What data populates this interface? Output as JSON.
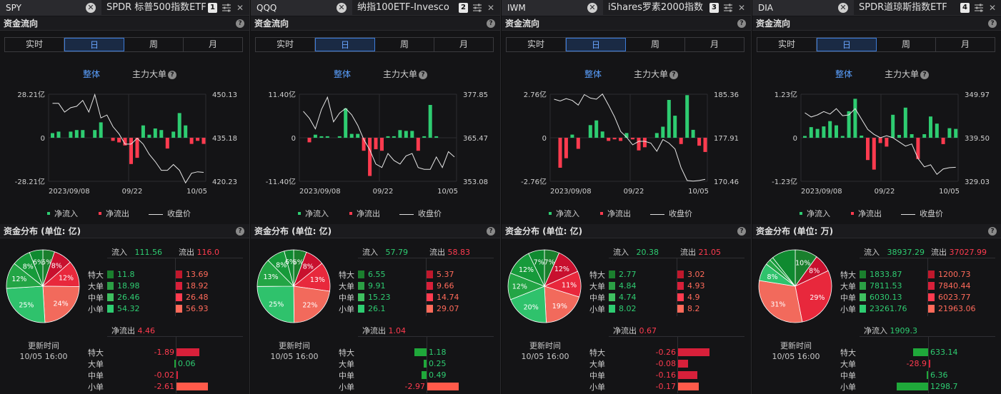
{
  "labels": {
    "flow_section": "资金流向",
    "dist_prefix": "资金分布 (单位: ",
    "dist_suffix": ")",
    "segments": [
      "实时",
      "日",
      "周",
      "月"
    ],
    "active_segment": "日",
    "mode_all": "整体",
    "mode_main": "主力大单",
    "legend_in": "净流入",
    "legend_out": "净流出",
    "legend_price": "收盘价",
    "inflow": "流入",
    "outflow": "流出",
    "row_labels": [
      "特大",
      "大单",
      "中单",
      "小单"
    ],
    "update_label": "更新时间",
    "update_time": "10/05 16:00"
  },
  "colors": {
    "green": "#2ecc71",
    "red": "#ff3b4f",
    "accent": "#5aa0ff"
  },
  "panels": [
    {
      "ticker": "SPY",
      "name": "SPDR 标普500指数ETF",
      "tab_index": "1",
      "unit": "亿",
      "chart_data": {
        "type": "bar",
        "y_left_ticks": [
          "28.21亿",
          "0",
          "-28.21亿"
        ],
        "y_right_ticks": [
          "450.13",
          "435.18",
          "420.23"
        ],
        "x_ticks": [
          "2023/09/08",
          "09/22",
          "10/05"
        ],
        "y_left_range": [
          -28.21,
          28.21
        ],
        "y_right_range": [
          420.23,
          450.13
        ],
        "net_flow": [
          3,
          4,
          0,
          4,
          5,
          5,
          0,
          5,
          10,
          0,
          -2,
          -3,
          -5,
          -17,
          -13,
          8,
          2,
          6,
          5,
          -7,
          4,
          16,
          8,
          -4,
          -2,
          -4
        ],
        "close": [
          447,
          447,
          444,
          445.5,
          446,
          448,
          444,
          450,
          442,
          443,
          439,
          436.5,
          433,
          433,
          435,
          433,
          429.5,
          427,
          424,
          424,
          426,
          424,
          419.7,
          423,
          423.5,
          423.3
        ]
      },
      "dist": {
        "inflow": "111.56",
        "outflow": "116.0",
        "in": [
          "11.8",
          "18.98",
          "26.46",
          "54.32"
        ],
        "out": [
          "13.69",
          "18.92",
          "26.48",
          "56.93"
        ],
        "net_label": "净流出",
        "net_value": "4.46",
        "net_sign": "out",
        "net": [
          "-1.89",
          "0.06",
          "-0.02",
          "-2.61"
        ],
        "pie": [
          {
            "label": "5%",
            "value": 5.2
          },
          {
            "label": "8%",
            "value": 8.3
          },
          {
            "label": "12%",
            "value": 11.6
          },
          {
            "label": "24%",
            "value": 23.9
          },
          {
            "label": "25%",
            "value": 24.9
          },
          {
            "label": "12%",
            "value": 11.6
          },
          {
            "label": "8%",
            "value": 8.3
          },
          {
            "label": "6%",
            "value": 6.0
          }
        ]
      }
    },
    {
      "ticker": "QQQ",
      "name": "纳指100ETF-Invesco",
      "tab_index": "2",
      "unit": "亿",
      "chart_data": {
        "type": "bar",
        "y_left_ticks": [
          "11.40亿",
          "0",
          "-11.40亿"
        ],
        "y_right_ticks": [
          "377.85",
          "365.47",
          "353.08"
        ],
        "x_ticks": [
          "2023/09/08",
          "09/22",
          "10/05"
        ],
        "y_left_range": [
          -11.4,
          11.4
        ],
        "y_right_range": [
          353.08,
          377.85
        ],
        "net_flow": [
          0,
          -1.2,
          0.8,
          0.4,
          0.4,
          0,
          0.4,
          7.7,
          1,
          1,
          -3.4,
          -10,
          -3,
          -3.4,
          0.4,
          0.4,
          2,
          1.8,
          1.8,
          -3.4,
          0.4,
          8.6,
          0.4,
          0,
          0,
          0
        ],
        "close": [
          373,
          371,
          368,
          373.5,
          377,
          370,
          372.5,
          373.8,
          372,
          369,
          365,
          362,
          358,
          357,
          361,
          359,
          358,
          360.3,
          361,
          357,
          356.5,
          356.5,
          360,
          357,
          361.5,
          360
        ]
      },
      "dist": {
        "inflow": "57.79",
        "outflow": "58.83",
        "in": [
          "6.55",
          "9.91",
          "15.23",
          "26.1"
        ],
        "out": [
          "5.37",
          "9.66",
          "14.74",
          "29.07"
        ],
        "net_label": "净流出",
        "net_value": "1.04",
        "net_sign": "out",
        "net": [
          "1.18",
          "0.25",
          "0.49",
          "-2.97"
        ],
        "pie": [
          {
            "label": "6%",
            "value": 5.7
          },
          {
            "label": "8%",
            "value": 8.5
          },
          {
            "label": "13%",
            "value": 13.0
          },
          {
            "label": "22%",
            "value": 22.6
          },
          {
            "label": "25%",
            "value": 25.1
          },
          {
            "label": "13%",
            "value": 12.7
          },
          {
            "label": "8%",
            "value": 8.2
          },
          {
            "label": "6%",
            "value": 4.2
          }
        ]
      }
    },
    {
      "ticker": "IWM",
      "name": "iShares罗素2000指数",
      "tab_index": "3",
      "unit": "亿",
      "chart_data": {
        "type": "bar",
        "y_left_ticks": [
          "2.76亿",
          "0",
          "-2.76亿"
        ],
        "y_right_ticks": [
          "185.36",
          "177.91",
          "170.46"
        ],
        "x_ticks": [
          "2023/09/08",
          "09/22",
          "10/05"
        ],
        "y_left_range": [
          -2.76,
          2.76
        ],
        "y_right_range": [
          170.46,
          185.36
        ],
        "net_flow": [
          0,
          -1.9,
          -1.3,
          0.2,
          -0.7,
          0,
          0.8,
          1.1,
          0.4,
          -0.2,
          -0.1,
          -0.2,
          0.3,
          -0.1,
          -0.8,
          -0.6,
          0,
          0.3,
          0.7,
          2.4,
          1.4,
          -0.4,
          2.7,
          0.5,
          -0.5,
          -0.9
        ],
        "close": [
          184.5,
          184.2,
          184.6,
          184.3,
          183.5,
          185.3,
          184.7,
          184.5,
          185.4,
          183.5,
          181.5,
          179,
          178,
          176.7,
          177.3,
          177.3,
          177,
          175.6,
          177.6,
          177,
          176,
          172.8,
          170.6,
          170.5,
          170.6,
          170.8
        ]
      },
      "dist": {
        "inflow": "20.38",
        "outflow": "21.05",
        "in": [
          "2.77",
          "4.84",
          "4.74",
          "8.02"
        ],
        "out": [
          "3.02",
          "4.93",
          "4.9",
          "8.2"
        ],
        "net_label": "净流出",
        "net_value": "0.67",
        "net_sign": "out",
        "net": [
          "-0.26",
          "-0.08",
          "-0.16",
          "-0.17"
        ],
        "pie": [
          {
            "label": "7%",
            "value": 6.6
          },
          {
            "label": "12%",
            "value": 11.7
          },
          {
            "label": "11%",
            "value": 11.5
          },
          {
            "label": "19%",
            "value": 19.4
          },
          {
            "label": "20%",
            "value": 19.8
          },
          {
            "label": "12%",
            "value": 11.9
          },
          {
            "label": "12%",
            "value": 11.9
          },
          {
            "label": "7%",
            "value": 7.2
          }
        ]
      }
    },
    {
      "ticker": "DIA",
      "name": "SPDR道琼斯指数ETF",
      "tab_index": "4",
      "unit": "万",
      "chart_data": {
        "type": "bar",
        "y_left_ticks": [
          "1.23亿",
          "0",
          "-1.23亿"
        ],
        "y_right_ticks": [
          "349.97",
          "339.50",
          "329.03"
        ],
        "x_ticks": [
          "2023/09/08",
          "09/22",
          "10/05"
        ],
        "y_left_range": [
          -1.23,
          1.23
        ],
        "y_right_range": [
          329.03,
          349.97
        ],
        "net_flow": [
          0.05,
          0.3,
          0.25,
          0.32,
          0.47,
          0.35,
          0.05,
          0.75,
          1.1,
          0.06,
          -0.63,
          -0.9,
          -0.15,
          -0.25,
          0.65,
          0.08,
          0.85,
          0.1,
          -0.6,
          0.1,
          0.6,
          0.4,
          -0.18,
          0.27,
          0.25
        ],
        "close": [
          345.5,
          344.5,
          345,
          345.8,
          345.2,
          346.5,
          344.8,
          345,
          346.5,
          344,
          341.5,
          340.3,
          339.5,
          340,
          339.5,
          338.5,
          337.5,
          338,
          334.5,
          332.5,
          333,
          330.7,
          332,
          332.3,
          332.4
        ]
      },
      "dist": {
        "inflow": "38937.29",
        "outflow": "37027.99",
        "in": [
          "1833.87",
          "7811.53",
          "6030.13",
          "23261.76"
        ],
        "out": [
          "1200.73",
          "7840.44",
          "6023.77",
          "21963.06"
        ],
        "net_label": "净流入",
        "net_value": "1909.3",
        "net_sign": "in",
        "net": [
          "633.14",
          "-28.9",
          "6.36",
          "1298.7"
        ],
        "pie": [
          {
            "label": "10%",
            "value": 10.0
          },
          {
            "label": "8%",
            "value": 8.0
          },
          {
            "label": "29%",
            "value": 28.9
          },
          {
            "label": "31%",
            "value": 30.6
          },
          {
            "label": "8%",
            "value": 7.9
          },
          {
            "label": "",
            "value": 2.4
          },
          {
            "label": "",
            "value": 1.6
          },
          {
            "label": "",
            "value": 10.6
          }
        ]
      }
    }
  ]
}
